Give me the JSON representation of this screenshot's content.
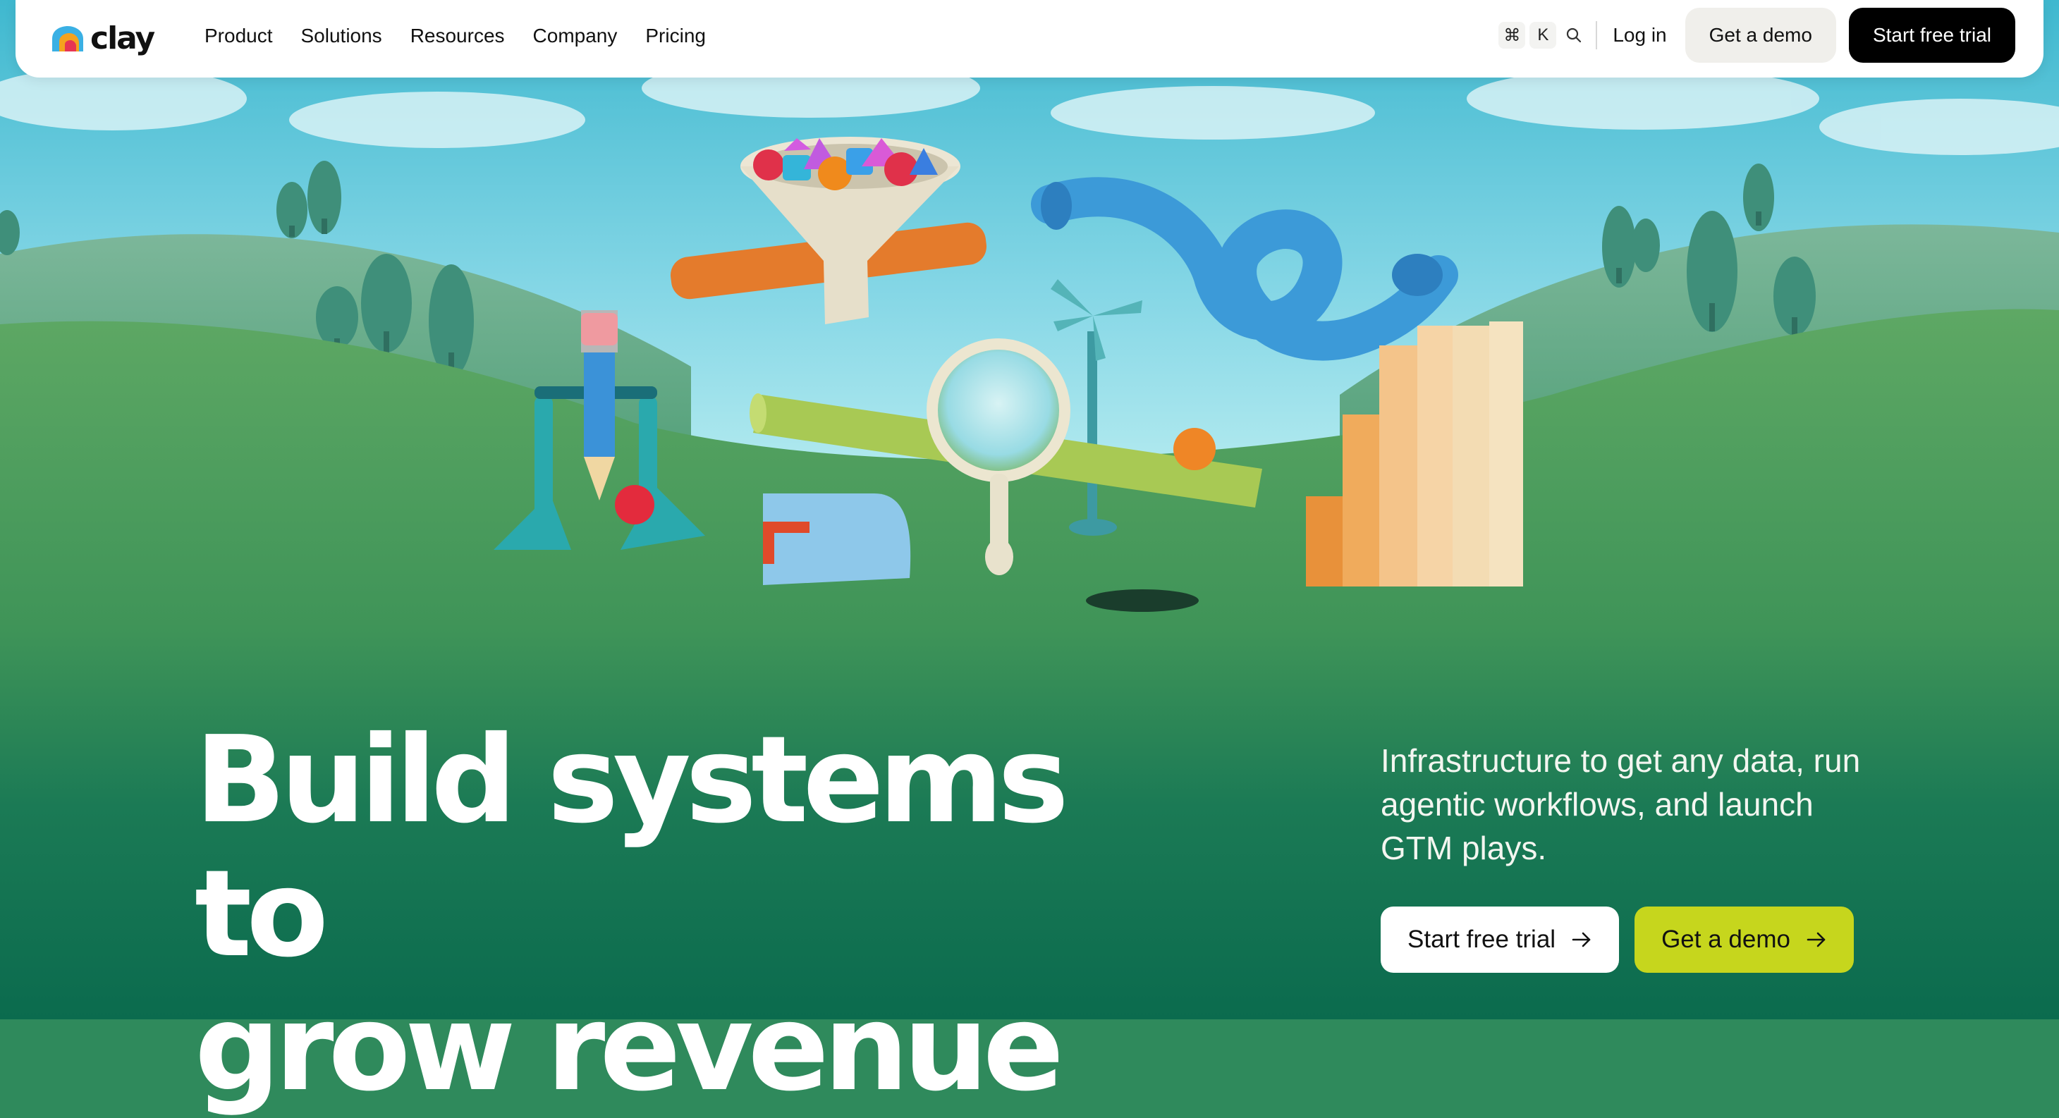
{
  "brand": {
    "name": "clay"
  },
  "nav": {
    "items": [
      "Product",
      "Solutions",
      "Resources",
      "Company",
      "Pricing"
    ],
    "shortcut_keys": [
      "⌘",
      "K"
    ],
    "login": "Log in",
    "demo": "Get a demo",
    "trial": "Start free trial"
  },
  "hero": {
    "headline_line1": "Build systems to",
    "headline_line2": "grow revenue",
    "subtitle": "Infrastructure to get any data, run agentic workflows, and launch GTM plays.",
    "cta_primary": "Start free trial",
    "cta_secondary": "Get a demo"
  },
  "icons": {
    "search": "search-icon",
    "arrow": "arrow-right-icon",
    "logo": "clay-logo-icon"
  },
  "colors": {
    "cta_demo": "#c6d61d",
    "dark_green": "#0e6b4f",
    "hill_green": "#4f9f5a"
  }
}
